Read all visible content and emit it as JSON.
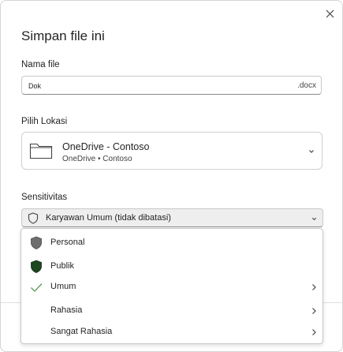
{
  "dialog": {
    "title": "Simpan file ini",
    "close_icon": "close-icon"
  },
  "filename": {
    "label": "Nama file",
    "value": "Dok",
    "extension": ".docx"
  },
  "location": {
    "label": "Pilih Lokasi",
    "primary": "OneDrive - Contoso",
    "secondary": "OneDrive • Contoso",
    "icon": "folder-icon"
  },
  "sensitivity": {
    "label": "Sensitivitas",
    "selected": "Karyawan Umum (tidak dibatasi)",
    "options": [
      {
        "label": "Personal",
        "icon": "shield-gray-icon",
        "submenu": false,
        "checked": false
      },
      {
        "label": "Publik",
        "icon": "shield-green-icon",
        "submenu": false,
        "checked": false
      },
      {
        "label": "Umum",
        "icon": "checkmark-icon",
        "submenu": true,
        "checked": true
      },
      {
        "label": "Rahasia",
        "icon": "",
        "submenu": true,
        "checked": false
      },
      {
        "label": "Sangat Rahasia",
        "icon": "",
        "submenu": true,
        "checked": false
      }
    ]
  },
  "colors": {
    "shield_gray": "#6e6e6e",
    "shield_green": "#1e4620",
    "check_green": "#5a9a5a",
    "border": "#c8c8c8"
  }
}
